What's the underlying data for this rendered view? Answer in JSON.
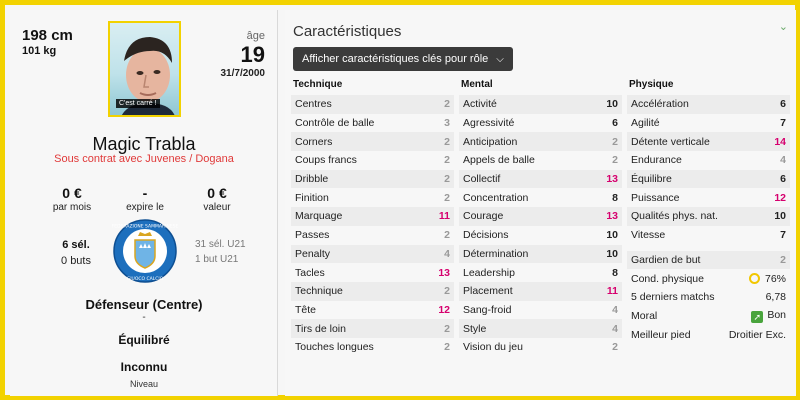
{
  "profile": {
    "height": "198 cm",
    "weight": "101 kg",
    "age_label": "âge",
    "age": "19",
    "birth_date": "31/7/2000",
    "photo_caption": "C'est carré !",
    "name": "Magic Trabla",
    "contract": "Sous contrat avec Juvenes / Dogana",
    "wage": {
      "value": "0 €",
      "label": "par mois"
    },
    "expiry": {
      "value": "-",
      "label": "expire le"
    },
    "market_value": {
      "value": "0 €",
      "label": "valeur"
    },
    "caps": "6 sél.",
    "goals": "0 buts",
    "u21_caps": "31 sél. U21",
    "u21_goals": "1 but U21",
    "position": "Défenseur (Centre)",
    "position_dash": "-",
    "balance": "Équilibré",
    "level_value": "Inconnu",
    "level_label": "Niveau",
    "crest_colors": {
      "blue": "#1d6fbd",
      "white": "#ffffff",
      "gold": "#d9a520"
    }
  },
  "attributes": {
    "title": "Caractéristiques",
    "role_button": "Afficher caractéristiques clés pour rôle",
    "technical": {
      "heading": "Technique",
      "rows": [
        {
          "label": "Centres",
          "value": "2",
          "level": "lo"
        },
        {
          "label": "Contrôle de balle",
          "value": "3",
          "level": "lo"
        },
        {
          "label": "Corners",
          "value": "2",
          "level": "lo"
        },
        {
          "label": "Coups francs",
          "value": "2",
          "level": "lo"
        },
        {
          "label": "Dribble",
          "value": "2",
          "level": "lo"
        },
        {
          "label": "Finition",
          "value": "2",
          "level": "lo"
        },
        {
          "label": "Marquage",
          "value": "11",
          "level": "hi"
        },
        {
          "label": "Passes",
          "value": "2",
          "level": "lo"
        },
        {
          "label": "Penalty",
          "value": "4",
          "level": "lo"
        },
        {
          "label": "Tacles",
          "value": "13",
          "level": "hi"
        },
        {
          "label": "Technique",
          "value": "2",
          "level": "lo"
        },
        {
          "label": "Tête",
          "value": "12",
          "level": "hi"
        },
        {
          "label": "Tirs de loin",
          "value": "2",
          "level": "lo"
        },
        {
          "label": "Touches longues",
          "value": "2",
          "level": "lo"
        }
      ]
    },
    "mental": {
      "heading": "Mental",
      "rows": [
        {
          "label": "Activité",
          "value": "10",
          "level": "mid"
        },
        {
          "label": "Agressivité",
          "value": "6",
          "level": "mid"
        },
        {
          "label": "Anticipation",
          "value": "2",
          "level": "lo"
        },
        {
          "label": "Appels de balle",
          "value": "2",
          "level": "lo"
        },
        {
          "label": "Collectif",
          "value": "13",
          "level": "hi"
        },
        {
          "label": "Concentration",
          "value": "8",
          "level": "mid"
        },
        {
          "label": "Courage",
          "value": "13",
          "level": "hi"
        },
        {
          "label": "Décisions",
          "value": "10",
          "level": "mid"
        },
        {
          "label": "Détermination",
          "value": "10",
          "level": "mid"
        },
        {
          "label": "Leadership",
          "value": "8",
          "level": "mid"
        },
        {
          "label": "Placement",
          "value": "11",
          "level": "hi"
        },
        {
          "label": "Sang-froid",
          "value": "4",
          "level": "lo"
        },
        {
          "label": "Style",
          "value": "4",
          "level": "lo"
        },
        {
          "label": "Vision du jeu",
          "value": "2",
          "level": "lo"
        }
      ]
    },
    "physical": {
      "heading": "Physique",
      "rows": [
        {
          "label": "Accélération",
          "value": "6",
          "level": "mid"
        },
        {
          "label": "Agilité",
          "value": "7",
          "level": "mid"
        },
        {
          "label": "Détente verticale",
          "value": "14",
          "level": "hi"
        },
        {
          "label": "Endurance",
          "value": "4",
          "level": "lo"
        },
        {
          "label": "Équilibre",
          "value": "6",
          "level": "mid"
        },
        {
          "label": "Puissance",
          "value": "12",
          "level": "hi"
        },
        {
          "label": "Qualités phys. nat.",
          "value": "10",
          "level": "mid"
        },
        {
          "label": "Vitesse",
          "value": "7",
          "level": "mid"
        }
      ],
      "goalkeeping": {
        "label": "Gardien de but",
        "value": "2"
      },
      "extras": [
        {
          "label": "Cond. physique",
          "value": "76%"
        },
        {
          "label": "5 derniers matchs",
          "value": "6,78"
        },
        {
          "label": "Moral",
          "value": "Bon"
        },
        {
          "label": "Meilleur pied",
          "value": "Droitier Exc."
        }
      ]
    }
  }
}
